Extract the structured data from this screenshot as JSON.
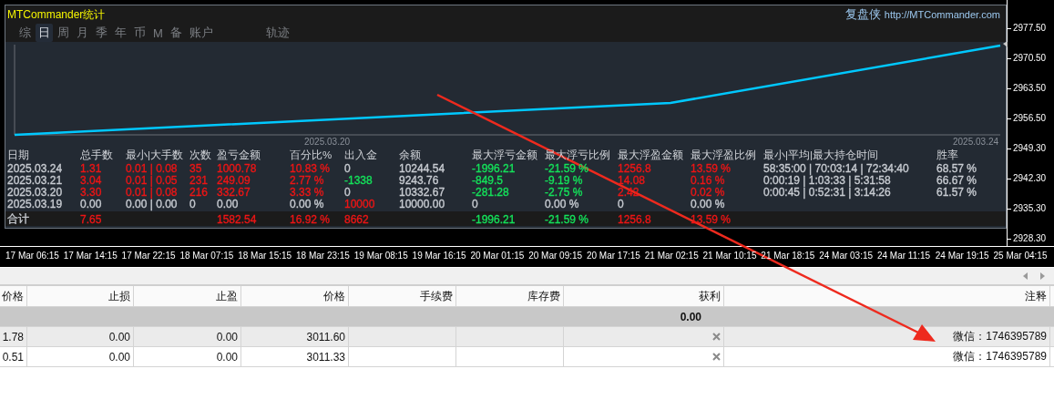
{
  "panel": {
    "title": "MTCommander统计",
    "brand": "复盘侠",
    "url": "http://MTCommander.com",
    "tabs": [
      {
        "label": "综",
        "selected": false
      },
      {
        "label": "日",
        "selected": true
      },
      {
        "label": "周",
        "selected": false
      },
      {
        "label": "月",
        "selected": false
      },
      {
        "label": "季",
        "selected": false
      },
      {
        "label": "年",
        "selected": false
      },
      {
        "label": "币",
        "selected": false
      },
      {
        "label": "M",
        "selected": false
      },
      {
        "label": "备",
        "selected": false
      },
      {
        "label": "账户",
        "selected": false
      },
      {
        "label": "轨迹",
        "selected": false
      }
    ],
    "plot": {
      "date_labels": [
        "2025.03.20",
        "2025.03.24"
      ]
    },
    "stats": {
      "columns": [
        "日期",
        "总手数",
        "最小|大手数",
        "次数",
        "盈亏金额",
        "百分比%",
        "出入金",
        "余额",
        "最大浮亏金额",
        "最大浮亏比例",
        "最大浮盈金额",
        "最大浮盈比例",
        "最小|平均|最大持仓时间",
        "胜率"
      ],
      "rows": [
        {
          "date": {
            "text": "2025.03.24",
            "color": "#c8ccd2"
          },
          "lots": {
            "text": "1.31",
            "color": "#ee1515"
          },
          "min_max_lots": {
            "text": "0.01 | 0.08",
            "color": "#ee1515"
          },
          "trades": {
            "text": "35",
            "color": "#ee1515"
          },
          "pnl": {
            "text": "1000.78",
            "color": "#ee1515"
          },
          "percent": {
            "text": "10.83 %",
            "color": "#ee1515"
          },
          "deposit": {
            "text": "0",
            "color": "#c8ccd2"
          },
          "balance": {
            "text": "10244.54",
            "color": "#c8ccd2"
          },
          "max_float_loss": {
            "text": "-1996.21",
            "color": "#14e25a"
          },
          "max_float_loss_pct": {
            "text": "-21.59 %",
            "color": "#14e25a"
          },
          "max_float_profit": {
            "text": "1256.8",
            "color": "#ee1515"
          },
          "max_float_profit_pct": {
            "text": "13.59 %",
            "color": "#ee1515"
          },
          "hold_times": {
            "text": "58:35:00 | 70:03:14 | 72:34:40",
            "color": "#c8ccd2"
          },
          "win_rate": {
            "text": "68.57 %",
            "color": "#c8ccd2"
          }
        },
        {
          "date": {
            "text": "2025.03.21",
            "color": "#c8ccd2"
          },
          "lots": {
            "text": "3.04",
            "color": "#ee1515"
          },
          "min_max_lots": {
            "text": "0.01 | 0.05",
            "color": "#ee1515"
          },
          "trades": {
            "text": "231",
            "color": "#ee1515"
          },
          "pnl": {
            "text": "249.09",
            "color": "#ee1515"
          },
          "percent": {
            "text": "2.77 %",
            "color": "#ee1515"
          },
          "deposit": {
            "text": "-1338",
            "color": "#14e25a"
          },
          "balance": {
            "text": "9243.76",
            "color": "#c8ccd2"
          },
          "max_float_loss": {
            "text": "-849.5",
            "color": "#14e25a"
          },
          "max_float_loss_pct": {
            "text": "-9.19 %",
            "color": "#14e25a"
          },
          "max_float_profit": {
            "text": "14.08",
            "color": "#ee1515"
          },
          "max_float_profit_pct": {
            "text": "0.16 %",
            "color": "#ee1515"
          },
          "hold_times": {
            "text": "0:00:19 | 1:03:33 | 5:31:58",
            "color": "#c8ccd2"
          },
          "win_rate": {
            "text": "66.67 %",
            "color": "#c8ccd2"
          }
        },
        {
          "date": {
            "text": "2025.03.20",
            "color": "#c8ccd2"
          },
          "lots": {
            "text": "3.30",
            "color": "#ee1515"
          },
          "min_max_lots": {
            "text": "0.01 | 0.08",
            "color": "#ee1515"
          },
          "trades": {
            "text": "216",
            "color": "#ee1515"
          },
          "pnl": {
            "text": "332.67",
            "color": "#ee1515"
          },
          "percent": {
            "text": "3.33 %",
            "color": "#ee1515"
          },
          "deposit": {
            "text": "0",
            "color": "#c8ccd2"
          },
          "balance": {
            "text": "10332.67",
            "color": "#c8ccd2"
          },
          "max_float_loss": {
            "text": "-281.28",
            "color": "#14e25a"
          },
          "max_float_loss_pct": {
            "text": "-2.75 %",
            "color": "#14e25a"
          },
          "max_float_profit": {
            "text": "2.42",
            "color": "#ee1515"
          },
          "max_float_profit_pct": {
            "text": "0.02 %",
            "color": "#ee1515"
          },
          "hold_times": {
            "text": "0:00:45 | 0:52:31 | 3:14:26",
            "color": "#c8ccd2"
          },
          "win_rate": {
            "text": "61.57 %",
            "color": "#c8ccd2"
          }
        },
        {
          "date": {
            "text": "2025.03.19",
            "color": "#c8ccd2"
          },
          "lots": {
            "text": "0.00",
            "color": "#c8ccd2"
          },
          "min_max_lots": {
            "text": "0.00 | 0.00",
            "color": "#c8ccd2"
          },
          "trades": {
            "text": "0",
            "color": "#c8ccd2"
          },
          "pnl": {
            "text": "0.00",
            "color": "#c8ccd2"
          },
          "percent": {
            "text": "0.00 %",
            "color": "#c8ccd2"
          },
          "deposit": {
            "text": "10000",
            "color": "#ee1515"
          },
          "balance": {
            "text": "10000.00",
            "color": "#c8ccd2"
          },
          "max_float_loss": {
            "text": "0",
            "color": "#c8ccd2"
          },
          "max_float_loss_pct": {
            "text": "0.00 %",
            "color": "#c8ccd2"
          },
          "max_float_profit": {
            "text": "0",
            "color": "#c8ccd2"
          },
          "max_float_profit_pct": {
            "text": "0.00 %",
            "color": "#c8ccd2"
          }
        }
      ],
      "total": {
        "date": {
          "text": "合计",
          "color": "#c8ccd2"
        },
        "lots": {
          "text": "7.65",
          "color": "#ee1515"
        },
        "pnl": {
          "text": "1582.54",
          "color": "#ee1515"
        },
        "percent": {
          "text": "16.92 %",
          "color": "#ee1515"
        },
        "deposit": {
          "text": "8662",
          "color": "#ee1515"
        },
        "max_float_loss": {
          "text": "-1996.21",
          "color": "#14e25a"
        },
        "max_float_loss_pct": {
          "text": "-21.59 %",
          "color": "#14e25a"
        },
        "max_float_profit": {
          "text": "1256.8",
          "color": "#ee1515"
        },
        "max_float_profit_pct": {
          "text": "13.59 %",
          "color": "#ee1515"
        }
      }
    }
  },
  "price_axis": [
    "2977.50",
    "2970.50",
    "2963.50",
    "2956.50",
    "2949.30",
    "2942.30",
    "2935.30",
    "2928.30"
  ],
  "time_axis": [
    "17 Mar 06:15",
    "17 Mar 14:15",
    "17 Mar 22:15",
    "18 Mar 07:15",
    "18 Mar 15:15",
    "18 Mar 23:15",
    "19 Mar 08:15",
    "19 Mar 16:15",
    "20 Mar 01:15",
    "20 Mar 09:15",
    "20 Mar 17:15",
    "21 Mar 02:15",
    "21 Mar 10:15",
    "21 Mar 18:15",
    "24 Mar 03:15",
    "24 Mar 11:15",
    "24 Mar 19:15",
    "25 Mar 04:15"
  ],
  "orders": {
    "columns": [
      "价格",
      "止损",
      "止盈",
      "价格",
      "手续费",
      "库存费",
      "获利",
      "注释"
    ],
    "total": "0.00",
    "rows": [
      {
        "cells": [
          "1.78",
          "0.00",
          "0.00",
          "3011.60"
        ],
        "closable": true,
        "comment": "微信：1746395789"
      },
      {
        "cells": [
          "0.51",
          "0.00",
          "0.00",
          "3011.33"
        ],
        "closable": true,
        "comment": "微信：1746395789"
      }
    ]
  }
}
